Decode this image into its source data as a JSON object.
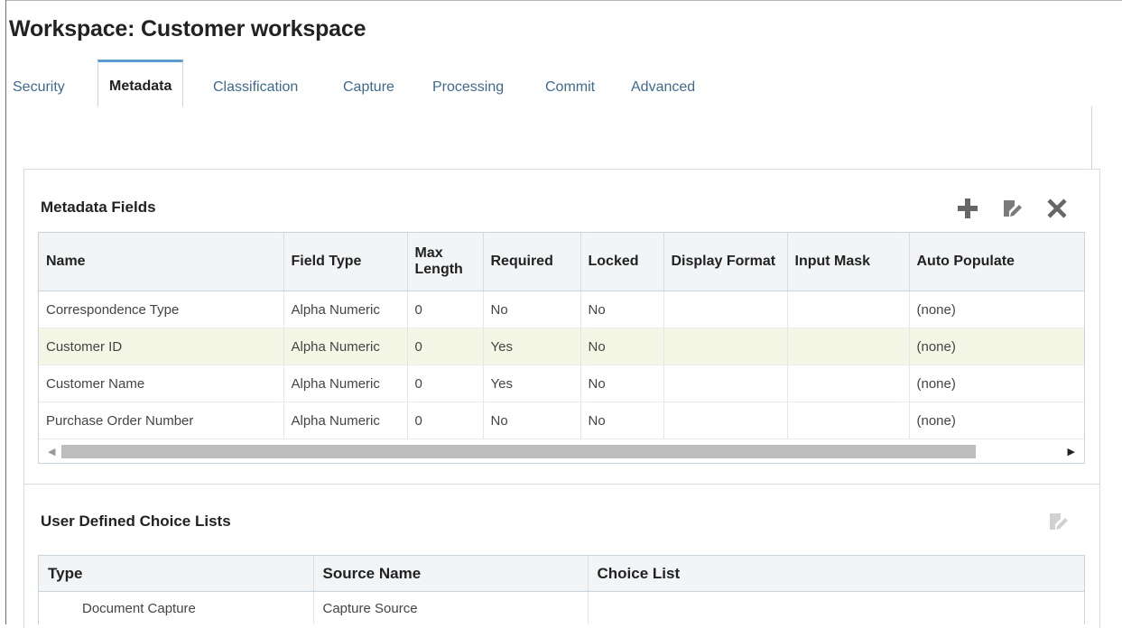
{
  "page": {
    "title": "Workspace: Customer workspace"
  },
  "tabs": [
    {
      "label": "Security"
    },
    {
      "label": "Metadata",
      "active": true
    },
    {
      "label": "Classification"
    },
    {
      "label": "Capture"
    },
    {
      "label": "Processing"
    },
    {
      "label": "Commit"
    },
    {
      "label": "Advanced"
    }
  ],
  "metadata_fields": {
    "title": "Metadata Fields",
    "toolbar": {
      "add_icon": "plus-icon",
      "edit_icon": "edit-icon",
      "delete_icon": "close-icon"
    },
    "columns": [
      "Name",
      "Field Type",
      "Max Length",
      "Required",
      "Locked",
      "Display Format",
      "Input Mask",
      "Auto Populate"
    ],
    "rows": [
      [
        "Correspondence Type",
        "Alpha Numeric",
        "0",
        "No",
        "No",
        "",
        "",
        "(none)"
      ],
      [
        "Customer ID",
        "Alpha Numeric",
        "0",
        "Yes",
        "No",
        "",
        "",
        "(none)"
      ],
      [
        "Customer Name",
        "Alpha Numeric",
        "0",
        "Yes",
        "No",
        "",
        "",
        "(none)"
      ],
      [
        "Purchase Order Number",
        "Alpha Numeric",
        "0",
        "No",
        "No",
        "",
        "",
        "(none)"
      ]
    ],
    "selected_row": 1
  },
  "choice_lists": {
    "title": "User Defined Choice Lists",
    "toolbar": {
      "edit_icon": "edit-icon"
    },
    "columns": [
      "Type",
      "Source Name",
      "Choice List"
    ],
    "rows": [
      [
        "Document Capture",
        "Capture Source",
        ""
      ]
    ]
  },
  "colors": {
    "tab_link": "#3f6a8e",
    "tab_accent": "#5b9fd2",
    "selected_row": "#f4f6e6",
    "header_bg": "#f2f4f6"
  }
}
